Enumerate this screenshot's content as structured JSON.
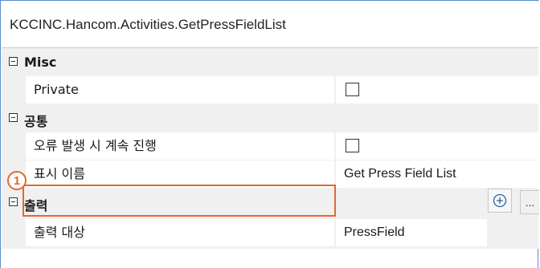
{
  "panel_title": "KCCINC.Hancom.Activities.GetPressFieldList",
  "categories": [
    {
      "label": "Misc",
      "props": [
        {
          "name": "Private",
          "value": "",
          "type": "checkbox"
        }
      ]
    },
    {
      "label": "공통",
      "props": [
        {
          "name": "오류 발생 시 계속 진행",
          "value": "",
          "type": "checkbox"
        },
        {
          "name": "표시 이름",
          "value": "Get Press Field List",
          "type": "text"
        }
      ]
    },
    {
      "label": "출력",
      "props": [
        {
          "name": "출력 대상",
          "value": "PressField",
          "type": "text"
        }
      ]
    }
  ],
  "callout_number": "1",
  "more_button_label": "...",
  "colors": {
    "border_blue": "#5b8fc9",
    "callout_orange": "#e0692e",
    "category_bg": "#f0f0f0"
  },
  "icons": {
    "collapse": "minus-box-icon",
    "add": "plus-circle-icon"
  }
}
